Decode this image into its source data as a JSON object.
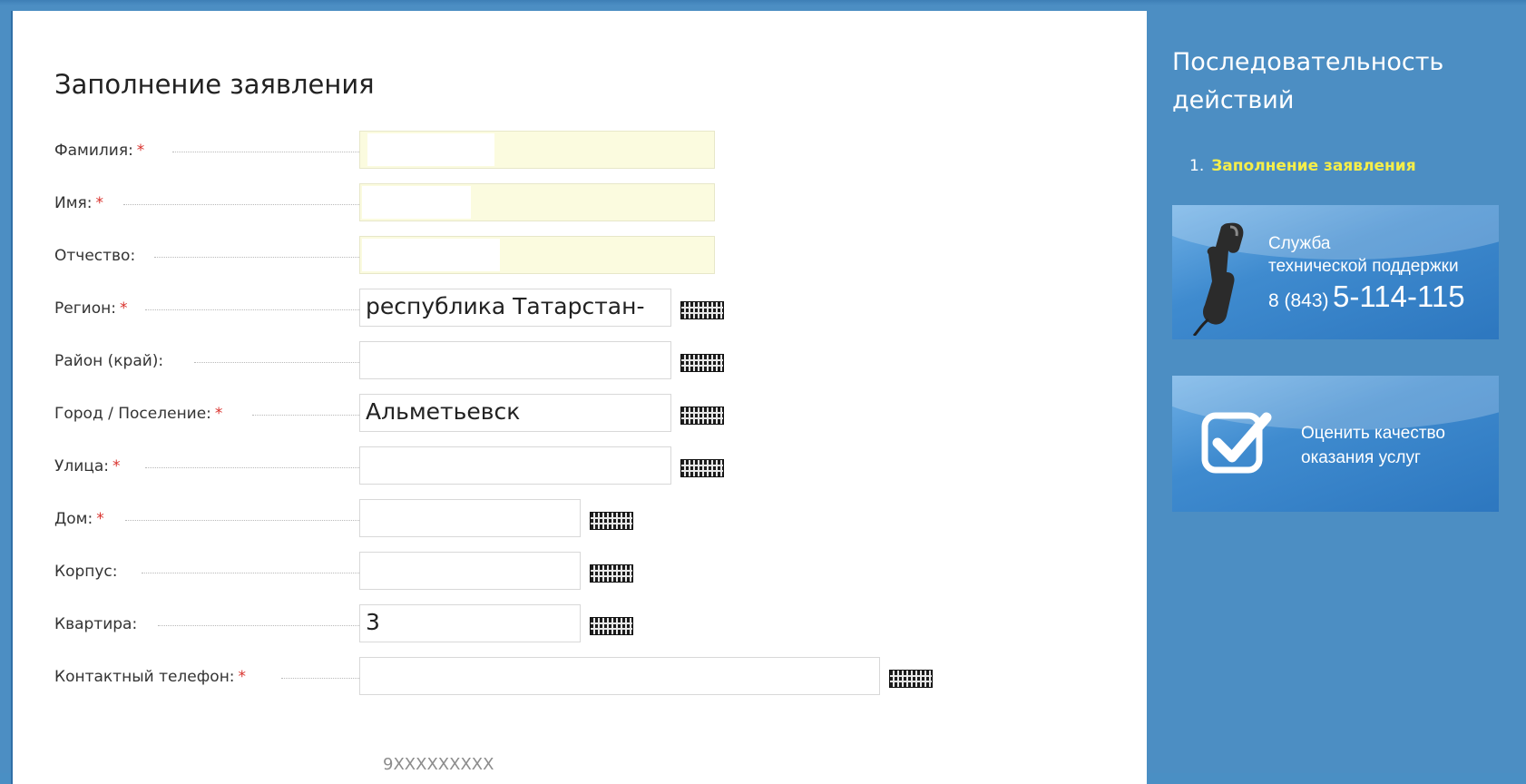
{
  "form": {
    "title": "Заполнение заявления",
    "required_mark": "*",
    "fields": {
      "surname": {
        "label": "Фамилия:",
        "value": "|",
        "required": true
      },
      "name": {
        "label": "Имя:",
        "value": "",
        "required": true
      },
      "patronymic": {
        "label": "Отчество:",
        "value": "",
        "required": false
      },
      "region": {
        "label": "Регион:",
        "value": "республика Татарстан-",
        "required": true
      },
      "district": {
        "label": "Район (край):",
        "value": "",
        "required": false
      },
      "city": {
        "label": "Город / Поселение:",
        "value": "Альметьевск",
        "required": true
      },
      "street": {
        "label": "Улица:",
        "value": "",
        "required": true
      },
      "house": {
        "label": "Дом:",
        "value": "",
        "required": true
      },
      "building": {
        "label": "Корпус:",
        "value": "",
        "required": false
      },
      "apartment": {
        "label": "Квартира:",
        "value": "3",
        "required": false
      },
      "phone": {
        "label": "Контактный телефон:",
        "value": "",
        "required": true,
        "hint": "9XXXXXXXXX"
      }
    },
    "keyboard_icon": "virtual-keyboard-icon"
  },
  "sidebar": {
    "title": "Последовательность действий",
    "steps": [
      {
        "number": "1.",
        "label": "Заполнение заявления"
      }
    ],
    "support_banner": {
      "line1": "Служба",
      "line2": "технической поддержки",
      "phone_code": "8 (843)",
      "phone_number": "5-114-115",
      "icon": "phone-handset-icon"
    },
    "quality_banner": {
      "line1": "Оценить качество",
      "line2": "оказания услуг",
      "icon": "checkbox-check-icon"
    }
  },
  "colors": {
    "accent_blue": "#4c8ec3",
    "required_star": "#d9322d",
    "active_step": "#f5ee4a",
    "highlight_field": "#fbfbdf"
  }
}
